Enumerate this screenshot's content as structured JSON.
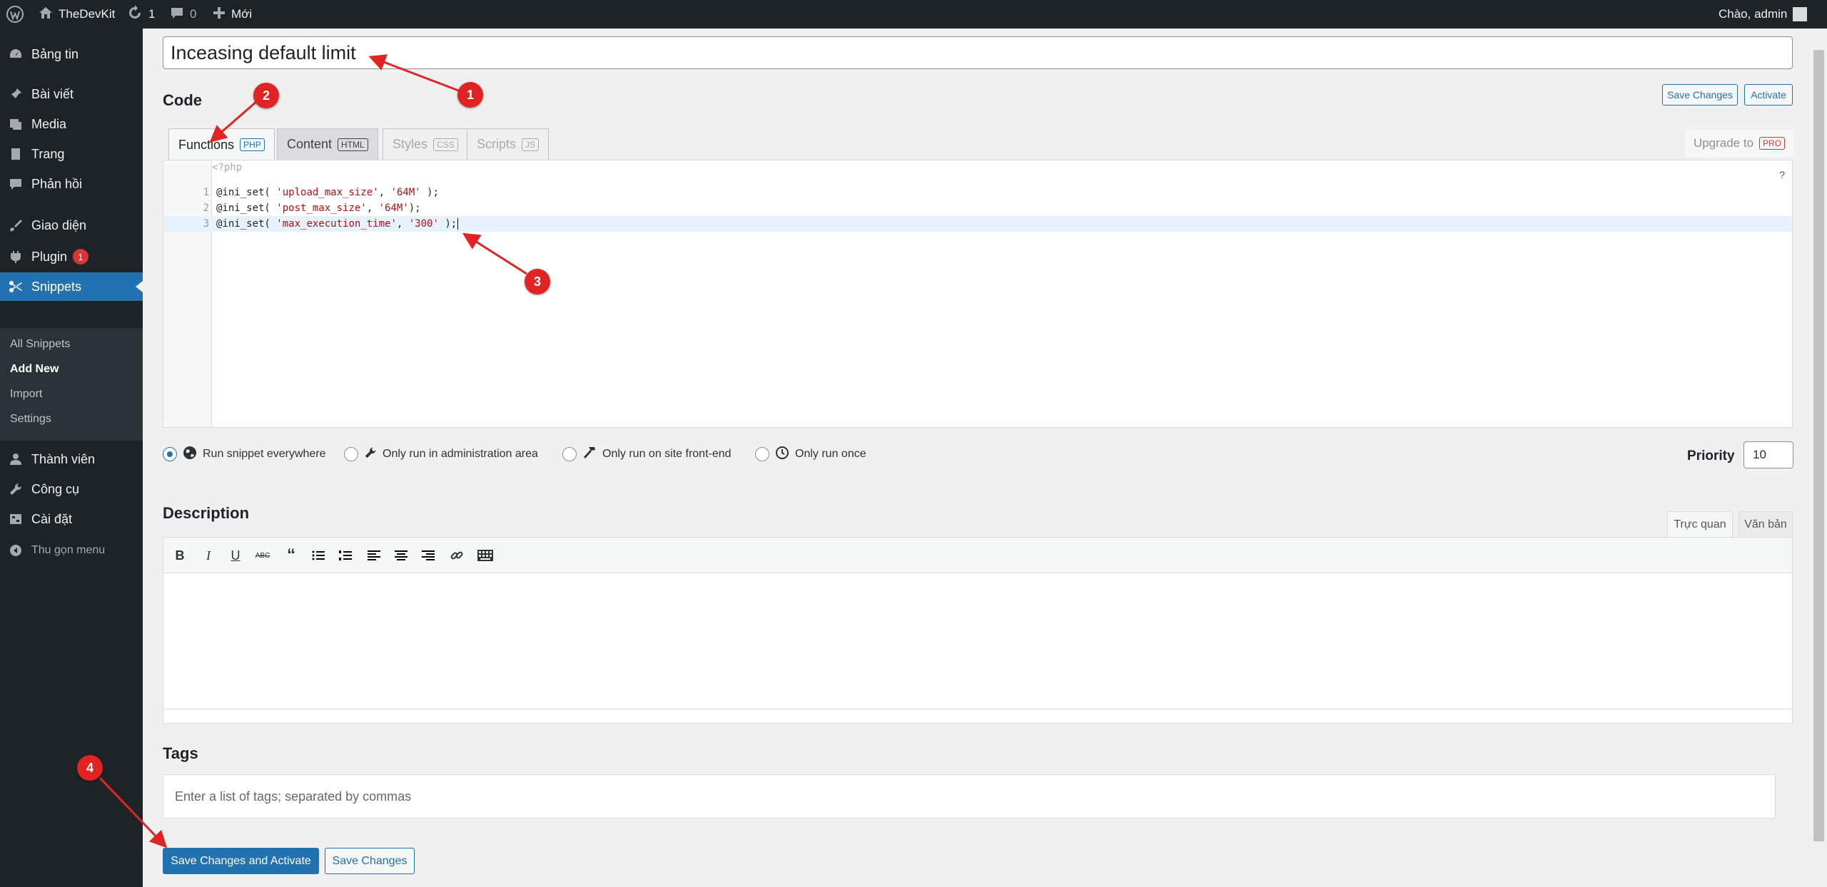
{
  "adminbar": {
    "site_name": "TheDevKit",
    "updates_count": "1",
    "comments_count": "0",
    "new_label": "Mới",
    "greeting": "Chào, admin"
  },
  "sidebar": {
    "items": [
      {
        "label": "Bảng tin",
        "icon": "dashboard-icon"
      },
      {
        "label": "Bài viết",
        "icon": "pin-icon"
      },
      {
        "label": "Media",
        "icon": "media-icon"
      },
      {
        "label": "Trang",
        "icon": "page-icon"
      },
      {
        "label": "Phản hồi",
        "icon": "comment-icon"
      },
      {
        "label": "Giao diện",
        "icon": "brush-icon"
      },
      {
        "label": "Plugin",
        "icon": "plugin-icon",
        "badge": "1"
      },
      {
        "label": "Snippets",
        "icon": "scissors-icon"
      },
      {
        "label": "Thành viên",
        "icon": "user-icon"
      },
      {
        "label": "Công cụ",
        "icon": "wrench-icon"
      },
      {
        "label": "Cài đặt",
        "icon": "settings-icon"
      },
      {
        "label": "Thu gọn menu",
        "icon": "collapse-icon"
      }
    ],
    "submenu": [
      "All Snippets",
      "Add New",
      "Import",
      "Settings"
    ]
  },
  "snippet": {
    "title": "Inceasing default limit",
    "code_heading": "Code",
    "save_changes": "Save Changes",
    "activate": "Activate"
  },
  "tabs": [
    {
      "label": "Functions",
      "tag": "PHP"
    },
    {
      "label": "Content",
      "tag": "HTML"
    },
    {
      "label": "Styles",
      "tag": "CSS"
    },
    {
      "label": "Scripts",
      "tag": "JS"
    }
  ],
  "upgrade": {
    "label": "Upgrade to",
    "tag": "PRO"
  },
  "editor": {
    "php_open": "<?php",
    "help": "?",
    "lines": [
      {
        "num": "1",
        "pre": "@ini_set( ",
        "str1": "'upload_max_size'",
        "mid": ", ",
        "str2": "'64M'",
        "post": " );"
      },
      {
        "num": "2",
        "pre": "@ini_set( ",
        "str1": "'post_max_size'",
        "mid": ", ",
        "str2": "'64M'",
        "post": ");"
      },
      {
        "num": "3",
        "pre": "@ini_set( ",
        "str1": "'max_execution_time'",
        "mid": ", ",
        "str2": "'300'",
        "post": " );"
      }
    ]
  },
  "scope": [
    {
      "label": "Run snippet everywhere",
      "selected": true
    },
    {
      "label": "Only run in administration area",
      "selected": false
    },
    {
      "label": "Only run on site front-end",
      "selected": false
    },
    {
      "label": "Only run once",
      "selected": false
    }
  ],
  "priority": {
    "label": "Priority",
    "value": "10"
  },
  "description": {
    "heading": "Description",
    "visual_tab": "Trực quan",
    "text_tab": "Văn bản"
  },
  "tags": {
    "heading": "Tags",
    "placeholder": "Enter a list of tags; separated by commas"
  },
  "footer": {
    "save_activate": "Save Changes and Activate",
    "save": "Save Changes"
  },
  "markers": [
    "1",
    "2",
    "3",
    "4"
  ],
  "colors": {
    "accent": "#2271b1",
    "marker": "#e02424",
    "admin_dark": "#1d2327"
  }
}
